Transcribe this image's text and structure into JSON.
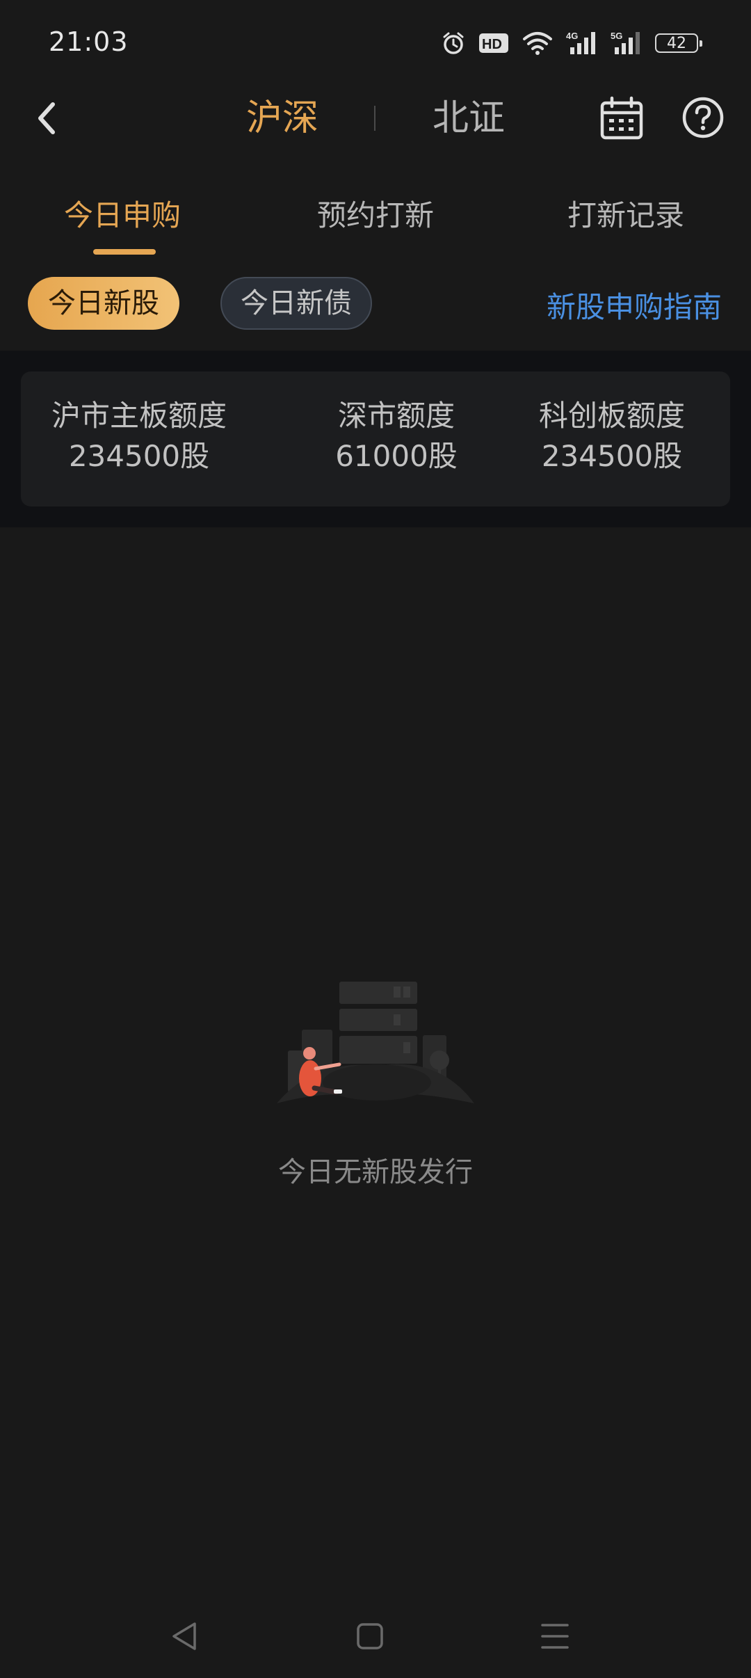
{
  "status_bar": {
    "time": "21:03",
    "battery": "42",
    "icons": [
      "alarm-icon",
      "hd-icon",
      "wifi-icon",
      "signal-4g-icon",
      "signal-5g-icon",
      "battery-icon"
    ]
  },
  "header": {
    "market_tabs": [
      {
        "label": "沪深",
        "active": true
      },
      {
        "label": "北证",
        "active": false
      }
    ],
    "icons": [
      "back-arrow-icon",
      "calendar-icon",
      "help-icon"
    ]
  },
  "sub_tabs": [
    {
      "label": "今日申购",
      "active": true
    },
    {
      "label": "预约打新",
      "active": false
    },
    {
      "label": "打新记录",
      "active": false
    }
  ],
  "filters": {
    "chips": [
      {
        "label": "今日新股",
        "selected": true
      },
      {
        "label": "今日新债",
        "selected": false
      }
    ],
    "guide_link": "新股申购指南"
  },
  "quota": [
    {
      "label": "沪市主板额度",
      "value": "234500股"
    },
    {
      "label": "深市额度",
      "value": "61000股"
    },
    {
      "label": "科创板额度",
      "value": "234500股"
    }
  ],
  "empty_state": {
    "text": "今日无新股发行"
  },
  "colors": {
    "background": "#191919",
    "accent": "#e5a653",
    "link": "#4a90e2"
  }
}
